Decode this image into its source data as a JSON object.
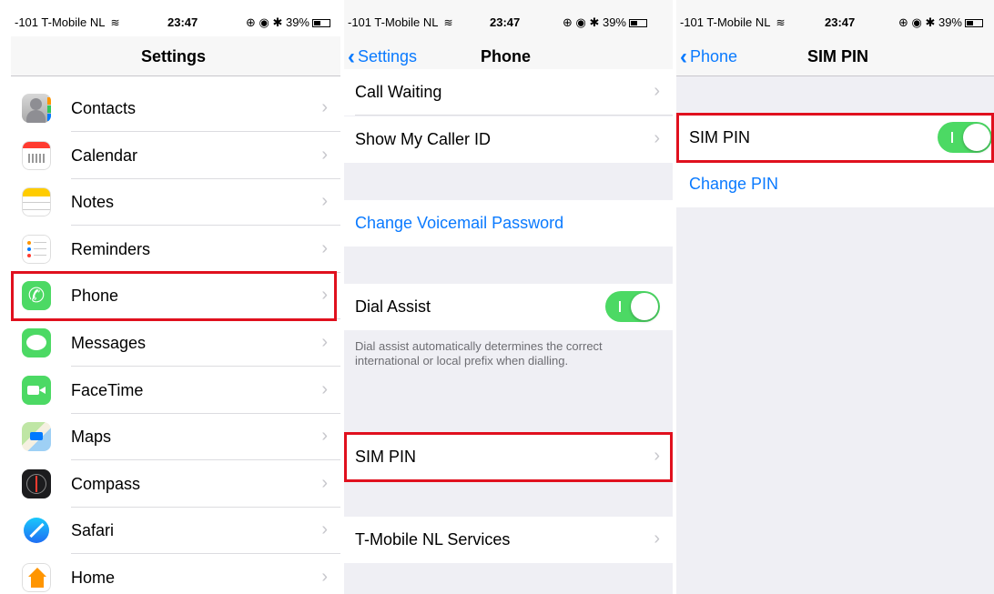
{
  "status": {
    "carrier": "-101 T-Mobile NL",
    "time": "23:47",
    "right": "⊕ ◉ ✱ 39%",
    "battery_level": 0.39
  },
  "panel1": {
    "title": "Settings",
    "items": [
      {
        "label": "Contacts",
        "icon": "contacts-icon"
      },
      {
        "label": "Calendar",
        "icon": "calendar-icon"
      },
      {
        "label": "Notes",
        "icon": "notes-icon"
      },
      {
        "label": "Reminders",
        "icon": "reminders-icon"
      },
      {
        "label": "Phone",
        "icon": "phone-icon"
      },
      {
        "label": "Messages",
        "icon": "messages-icon"
      },
      {
        "label": "FaceTime",
        "icon": "facetime-icon"
      },
      {
        "label": "Maps",
        "icon": "maps-icon"
      },
      {
        "label": "Compass",
        "icon": "compass-icon"
      },
      {
        "label": "Safari",
        "icon": "safari-icon"
      },
      {
        "label": "Home",
        "icon": "home-icon"
      }
    ]
  },
  "panel2": {
    "back": "Settings",
    "title": "Phone",
    "call_waiting": "Call Waiting",
    "show_caller_id": "Show My Caller ID",
    "change_voicemail": "Change Voicemail Password",
    "dial_assist": "Dial Assist",
    "dial_assist_on": true,
    "dial_assist_note": "Dial assist automatically determines the correct international or local prefix when dialling.",
    "sim_pin": "SIM PIN",
    "services": "T-Mobile NL Services"
  },
  "panel3": {
    "back": "Phone",
    "title": "SIM PIN",
    "sim_pin": "SIM PIN",
    "sim_pin_on": true,
    "change_pin": "Change PIN"
  },
  "colors": {
    "accent": "#0a7aff",
    "toggle_on": "#4cd964",
    "highlight": "#e0101e"
  }
}
